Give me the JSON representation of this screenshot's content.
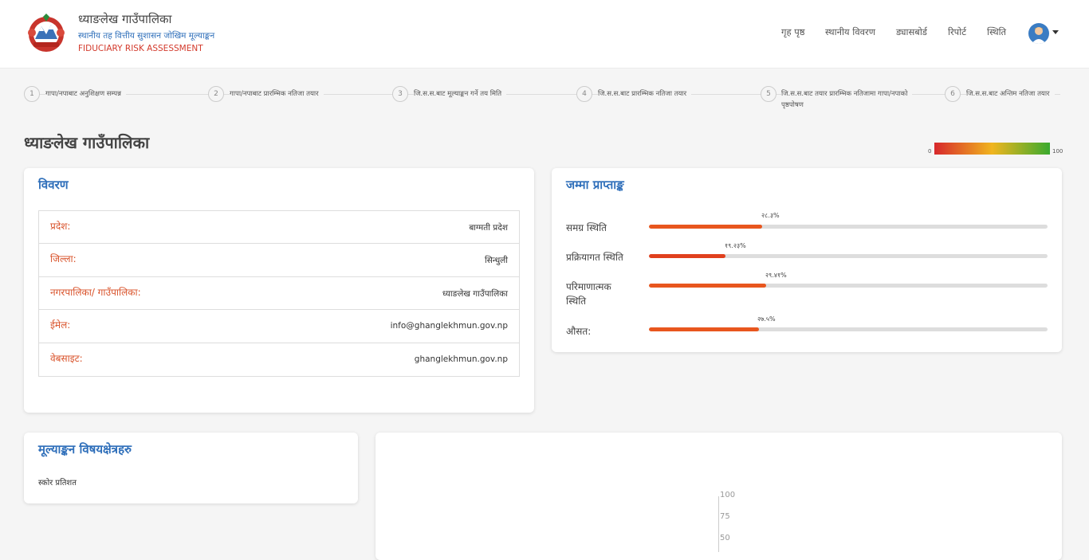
{
  "header": {
    "title": "ध्याङलेख गाउँपालिका",
    "subtitle": "स्थानीय तह वित्तीय सुशासन जोखिम मूल्याङ्कन",
    "subtitle_en": "FIDUCIARY RISK ASSESSMENT",
    "logo_icon": "nepal-emblem-icon",
    "nav": [
      "गृह पृष्ठ",
      "स्थानीय विवरण",
      "ड्यासबोर्ड",
      "रिपोर्ट",
      "स्थिति"
    ],
    "avatar_icon": "user-avatar-icon"
  },
  "steps": [
    {
      "num": "1",
      "label": "गापा/नपाबाट अनुशिक्षण सम्पन्न"
    },
    {
      "num": "2",
      "label": "गापा/नपाबाट प्रारम्भिक नतिजा तयार"
    },
    {
      "num": "3",
      "label": "जि.स.स.बाट मूल्याङ्कन गर्ने तय मिति"
    },
    {
      "num": "4",
      "label": "जि.स.स.बाट प्रारम्भिक नतिजा तयार"
    },
    {
      "num": "5",
      "label": "जि.स.स.बाट तयार प्रारम्भिक नतिजामा गापा/नपाको",
      "label2": "पृष्ठपोषण"
    },
    {
      "num": "6",
      "label": "जि.स.स.बाट अन्तिम नतिजा तयार"
    }
  ],
  "page_title": "ध्याङलेख गाउँपालिका",
  "scale": {
    "min": "0",
    "max": "100",
    "colors": [
      "#d7282c",
      "#f0b51f",
      "#3aaa2f"
    ]
  },
  "details": {
    "title": "विवरण",
    "rows": [
      {
        "label": "प्रदेश:",
        "value": "बाग्मती प्रदेश"
      },
      {
        "label": "जिल्ला:",
        "value": "सिन्धुली"
      },
      {
        "label": "नगरपालिका/ गाउँपालिका:",
        "value": "ध्याङलेख गाउँपालिका"
      },
      {
        "label": "ईमेल:",
        "value": "info@ghanglekhmun.gov.np"
      },
      {
        "label": "वेबसाइट:",
        "value": "ghanglekhmun.gov.np"
      }
    ]
  },
  "scores": {
    "title": "जम्मा प्राप्ताङ्क",
    "items": [
      {
        "label": "समग्र स्थिति",
        "pct_text": "२८.३%",
        "value": 28.3,
        "color": "#e8561e"
      },
      {
        "label": "प्रक्रियागत स्थिति",
        "pct_text": "१९.२३%",
        "value": 19.23,
        "color": "#e0401d"
      },
      {
        "label": "परिमाणात्मक",
        "label2": "स्थिति",
        "pct_text": "२९.४१%",
        "value": 29.41,
        "color": "#e8561e"
      },
      {
        "label": "औसत:",
        "pct_text": "२७.५%",
        "value": 27.5,
        "color": "#e8561e"
      }
    ]
  },
  "areas": {
    "title": "मूल्याङ्कन विषयक्षेत्रहरु",
    "caption": "स्कोर प्रतिशत"
  },
  "chart": {
    "ticks": [
      "100",
      "75",
      "50"
    ]
  }
}
